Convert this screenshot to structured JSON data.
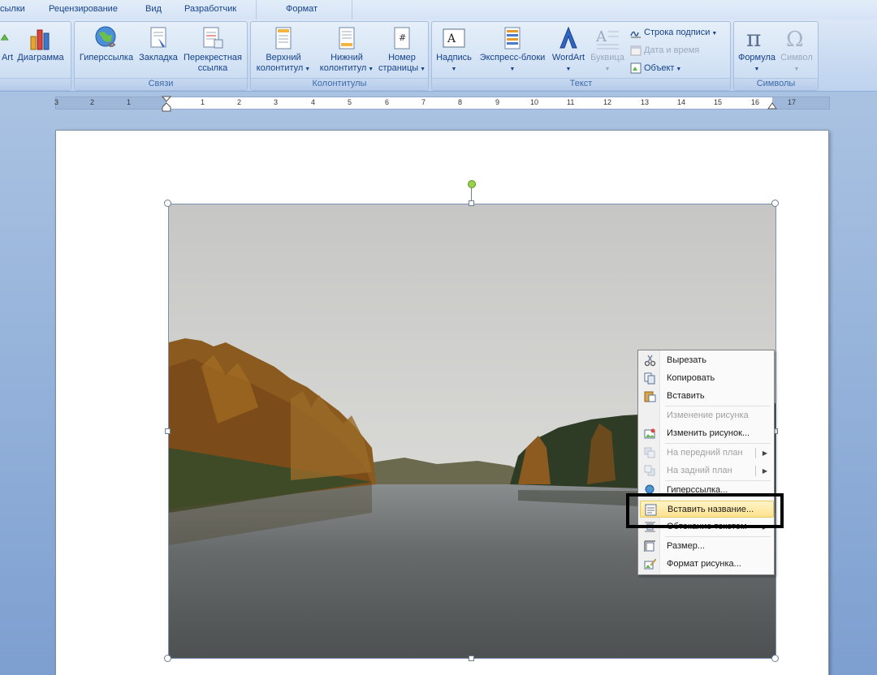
{
  "tabs": [
    "сылки",
    "Рецензирование",
    "Вид",
    "Разработчик",
    "Формат"
  ],
  "ribbon": {
    "groups": [
      {
        "label": ""
      },
      {
        "label": "Связи"
      },
      {
        "label": "Колонтитулы"
      },
      {
        "label": "Текст"
      },
      {
        "label": "Символы"
      }
    ],
    "illustrations": {
      "smartart": "Art",
      "chart": "Диаграмма"
    },
    "links": {
      "hyperlink": "Гиперссылка",
      "bookmark": "Закладка",
      "crossref_1": "Перекрестная",
      "crossref_2": "ссылка"
    },
    "headers": {
      "header_1": "Верхний",
      "header_2": "колонтитул",
      "footer_1": "Нижний",
      "footer_2": "колонтитул",
      "pagenum_1": "Номер",
      "pagenum_2": "страницы"
    },
    "text": {
      "textbox": "Надпись",
      "quickparts": "Экспресс-блоки",
      "wordart": "WordArt",
      "dropcap": "Буквица",
      "signature": "Строка подписи",
      "datetime": "Дата и время",
      "object": "Объект"
    },
    "symbols": {
      "equation": "Формула",
      "symbol": "Символ"
    }
  },
  "ruler": {
    "numbers": [
      "3",
      "2",
      "1",
      "1",
      "2",
      "3",
      "4",
      "5",
      "6",
      "7",
      "8",
      "9",
      "10",
      "11",
      "12",
      "13",
      "14",
      "15",
      "16",
      "17"
    ]
  },
  "context_menu": {
    "items": [
      {
        "label": "Вырезать",
        "icon": "scissors-icon",
        "disabled": false
      },
      {
        "label": "Копировать",
        "icon": "copy-icon",
        "disabled": false
      },
      {
        "label": "Вставить",
        "icon": "paste-icon",
        "disabled": false
      },
      {
        "label": "Изменение рисунка",
        "icon": "",
        "disabled": true
      },
      {
        "label": "Изменить рисунок...",
        "icon": "change-picture-icon",
        "disabled": false
      },
      {
        "label": "На передний план",
        "icon": "bring-forward-icon",
        "disabled": true
      },
      {
        "label": "На задний план",
        "icon": "send-backward-icon",
        "disabled": true
      },
      {
        "label": "Гиперссылка...",
        "icon": "hyperlink-icon",
        "disabled": false
      },
      {
        "label": "Вставить название...",
        "icon": "insert-caption-icon",
        "disabled": false
      },
      {
        "label": "Обтекание текстом",
        "icon": "text-wrap-icon",
        "disabled": false
      },
      {
        "label": "Размер...",
        "icon": "size-icon",
        "disabled": false
      },
      {
        "label": "Формат рисунка...",
        "icon": "format-picture-icon",
        "disabled": false
      }
    ]
  },
  "colors": {
    "highlight": "#fee28f",
    "ribbon": "#c8daf1",
    "tab_text": "#15428b"
  }
}
